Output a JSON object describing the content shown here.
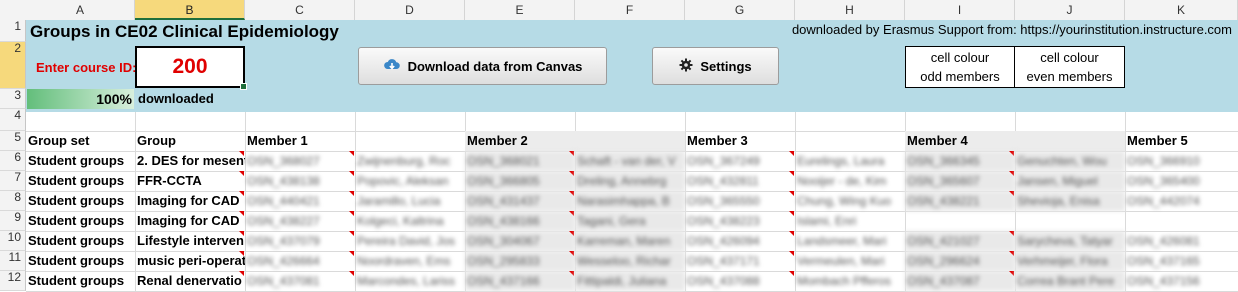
{
  "columns": [
    "A",
    "B",
    "C",
    "D",
    "E",
    "F",
    "G",
    "H",
    "I",
    "J",
    "K"
  ],
  "rows": [
    "1",
    "2",
    "3",
    "4",
    "5",
    "6",
    "7",
    "8",
    "9",
    "10",
    "11",
    "12"
  ],
  "title": "Groups in CE02 Clinical Epidemiology",
  "source_note": "downloaded by Erasmus Support from: https://yourinstitution.instructure.com",
  "course": {
    "label": "Enter course ID:",
    "value": "200"
  },
  "buttons": {
    "download": "Download data from Canvas",
    "settings": "Settings"
  },
  "legend": {
    "odd": [
      "cell colour",
      "odd members"
    ],
    "even": [
      "cell colour",
      "even members"
    ]
  },
  "progress": {
    "percent_value": 100,
    "text": "100%",
    "label": "downloaded"
  },
  "headers": {
    "group_set": "Group set",
    "group": "Group",
    "members": [
      "Member 1",
      "Member 2",
      "Member 3",
      "Member 4",
      "Member 5"
    ]
  },
  "groups": [
    {
      "set": "Student groups",
      "name": "2. DES for mesent",
      "members": [
        [
          "OSN_368027",
          "Zwijnenburg, Roc"
        ],
        [
          "OSN_368021",
          "Schaft - van der, V"
        ],
        [
          "OSN_367249",
          "Eurelings, Laura"
        ],
        [
          "OSN_366345",
          "Genuchten, Wou"
        ],
        [
          "OSN_366910",
          ""
        ]
      ]
    },
    {
      "set": "Student groups",
      "name": "FFR-CCTA",
      "members": [
        [
          "OSN_438138",
          "Popovic, Aleksan"
        ],
        [
          "OSN_366805",
          "Dreling, Annebrg"
        ],
        [
          "OSN_432811",
          "Nooijer - de, Kim"
        ],
        [
          "OSN_365607",
          "Jansen, Miguel"
        ],
        [
          "OSN_365400",
          ""
        ]
      ]
    },
    {
      "set": "Student groups",
      "name": "Imaging for CAD",
      "members": [
        [
          "OSN_440421",
          "Jaramillo, Lucia"
        ],
        [
          "OSN_431437",
          "Narasimhappa, B"
        ],
        [
          "OSN_365550",
          "Chung, Wing Kuo"
        ],
        [
          "OSN_438221",
          "Shevioja, Enisa"
        ],
        [
          "OSN_442074",
          ""
        ]
      ]
    },
    {
      "set": "Student groups",
      "name": "Imaging for CAD",
      "members": [
        [
          "OSN_438227",
          "Kolgeci, Kaltrina"
        ],
        [
          "OSN_438166",
          "Tagani, Gera"
        ],
        [
          "OSN_438223",
          "Islami, Enri"
        ],
        [
          "",
          ""
        ],
        [
          "",
          ""
        ]
      ]
    },
    {
      "set": "Student groups",
      "name": "Lifestyle interven",
      "members": [
        [
          "OSN_437079",
          "Pereira David, Jos"
        ],
        [
          "OSN_304067",
          "Karreman, Maren"
        ],
        [
          "OSN_426094",
          "Landsmeer, Mari"
        ],
        [
          "OSN_421027",
          "Sarycheva, Tatyar"
        ],
        [
          "OSN_426081",
          ""
        ]
      ]
    },
    {
      "set": "Student groups",
      "name": "music peri-operat",
      "members": [
        [
          "OSN_426664",
          "Noordraven, Ems"
        ],
        [
          "OSN_295833",
          "Wesseloo, Richar"
        ],
        [
          "OSN_437171",
          "Vermeulen, Mari"
        ],
        [
          "OSN_296624",
          "Verhmeijer, Flora"
        ],
        [
          "OSN_437165",
          ""
        ]
      ]
    },
    {
      "set": "Student groups",
      "name": "Renal denervatio",
      "members": [
        [
          "OSN_437081",
          "Marcondes, Lariss"
        ],
        [
          "OSN_437166",
          "Fittipaldi, Juliana"
        ],
        [
          "OSN_437088",
          "Mombach Pfferos"
        ],
        [
          "OSN_437087",
          "Correa Brant Pere"
        ],
        [
          "OSN_437156",
          ""
        ]
      ]
    }
  ]
}
